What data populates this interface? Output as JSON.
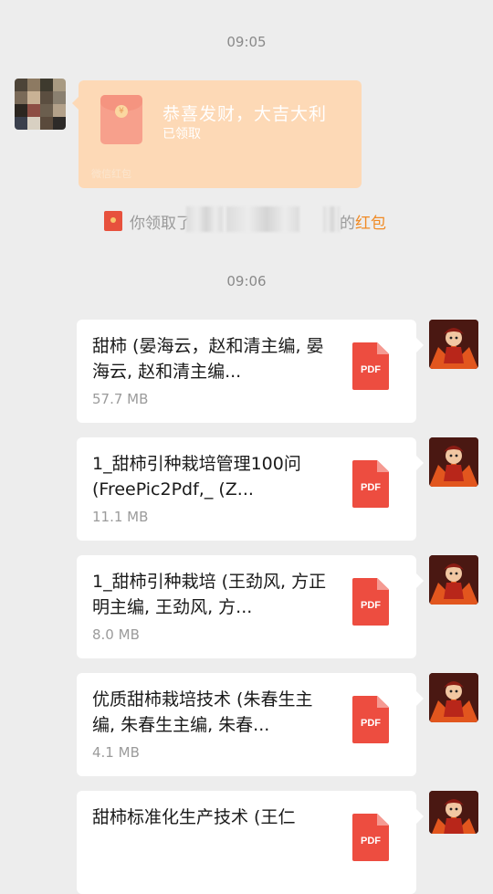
{
  "timestamps": [
    "09:05",
    "09:06"
  ],
  "red_packet": {
    "title": "恭喜发财，大吉大利",
    "status": "已领取",
    "footer": "微信红包",
    "icon": "red-packet-icon",
    "color": "#fdd9b6"
  },
  "notice": {
    "prefix": "你领取了",
    "suffix": "的",
    "link_text": "红包",
    "link_color": "#f08a24"
  },
  "files": [
    {
      "name": "甜柿 (晏海云，赵和清主编, 晏海云, 赵和清主编...",
      "size": "57.7 MB",
      "type": "PDF"
    },
    {
      "name": "1_甜柿引种栽培管理100问 (FreePic2Pdf,_ (Z...",
      "size": "11.1 MB",
      "type": "PDF"
    },
    {
      "name": "1_甜柿引种栽培 (王劲风, 方正明主编, 王劲风, 方...",
      "size": "8.0 MB",
      "type": "PDF"
    },
    {
      "name": "优质甜柿栽培技术 (朱春生主编, 朱春生主编, 朱春...",
      "size": "4.1 MB",
      "type": "PDF"
    },
    {
      "name": "甜柿标准化生产技术 (王仁",
      "size": "",
      "type": "PDF"
    }
  ]
}
